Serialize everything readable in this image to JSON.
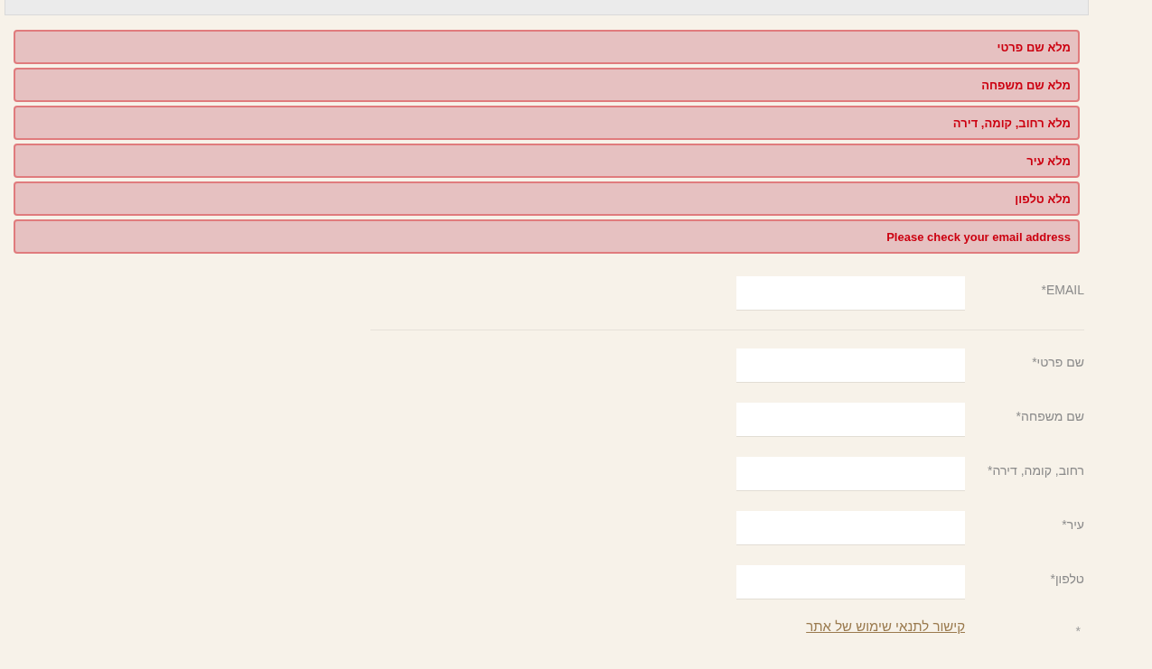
{
  "errors": [
    {
      "text": "מלא שם פרטי"
    },
    {
      "text": "מלא שם משפחה"
    },
    {
      "text": "מלא רחוב, קומה, דירה"
    },
    {
      "text": "מלא עיר"
    },
    {
      "text": "מלא טלפון"
    },
    {
      "text": "Please check your email address"
    }
  ],
  "form": {
    "email": {
      "label": "EMAIL*"
    },
    "fields": [
      {
        "label": "שם פרטי*"
      },
      {
        "label": "שם משפחה*"
      },
      {
        "label": "רחוב, קומה, דירה*"
      },
      {
        "label": "עיר*"
      },
      {
        "label": "טלפון*"
      }
    ],
    "terms": {
      "mark": "*",
      "link": "קישור לתנאי שימוש של אתר"
    }
  }
}
